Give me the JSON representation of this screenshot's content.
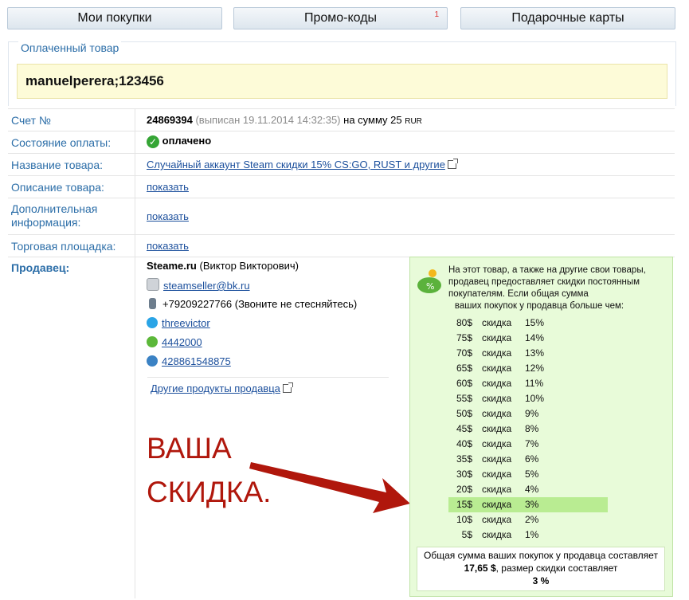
{
  "tabs": [
    {
      "label": "Мои покупки"
    },
    {
      "label": "Промо-коды",
      "badge": "1"
    },
    {
      "label": "Подарочные карты"
    }
  ],
  "paid": {
    "legend": "Оплаченный товар",
    "value": "manuelperera;123456"
  },
  "invoice": {
    "label": "Счет №",
    "number": "24869394",
    "issued": "(выписан 19.11.2014 14:32:35)",
    "sum_text": "на сумму 25",
    "currency": "RUR"
  },
  "status": {
    "label": "Состояние оплаты:",
    "value": "оплачено"
  },
  "product": {
    "label": "Название товара:",
    "value": "Случайный аккаунт Steam скидки 15% CS:GO, RUST и другие"
  },
  "description": {
    "label": "Описание товара:",
    "value": "показать"
  },
  "extra": {
    "label": "Дополнительная информация:",
    "value": "показать"
  },
  "market": {
    "label": "Торговая площадка:",
    "value": "показать"
  },
  "seller": {
    "label": "Продавец:",
    "name": "Steame.ru",
    "person": "(Виктор Викторович)",
    "email": "steamseller@bk.ru",
    "phone": "+79209227766 (Звоните не стесняйтесь)",
    "skype": "threevictor",
    "icq": "4442000",
    "wm": "428861548875",
    "other_products": "Другие продукты продавца"
  },
  "callout": {
    "line1": "ВАША",
    "line2": "СКИДКА."
  },
  "discount": {
    "intro1": "На этот товар, а также на другие свои товары, продавец предоставляет скидки постоянным покупателям. Если общая сумма",
    "intro2": "ваших покупок у продавца больше чем:",
    "word": "скидка",
    "tiers": [
      {
        "amount": "80$",
        "pct": "15%"
      },
      {
        "amount": "75$",
        "pct": "14%"
      },
      {
        "amount": "70$",
        "pct": "13%"
      },
      {
        "amount": "65$",
        "pct": "12%"
      },
      {
        "amount": "60$",
        "pct": "11%"
      },
      {
        "amount": "55$",
        "pct": "10%"
      },
      {
        "amount": "50$",
        "pct": "9%"
      },
      {
        "amount": "45$",
        "pct": "8%"
      },
      {
        "amount": "40$",
        "pct": "7%"
      },
      {
        "amount": "35$",
        "pct": "6%"
      },
      {
        "amount": "30$",
        "pct": "5%"
      },
      {
        "amount": "20$",
        "pct": "4%"
      },
      {
        "amount": "15$",
        "pct": "3%",
        "highlight": true
      },
      {
        "amount": "10$",
        "pct": "2%"
      },
      {
        "amount": "5$",
        "pct": "1%"
      }
    ],
    "summary_pre": "Общая сумма ваших покупок у продавца составляет",
    "summary_amount": "17,65 $",
    "summary_mid": ", размер скидки составляет",
    "summary_pct": "3 %"
  },
  "colors": {
    "accent": "#2c6ea8",
    "link": "#1b4f9c",
    "callout": "#b0170c",
    "discount_bg": "#e8fbd9",
    "highlight": "#b9ec92"
  }
}
